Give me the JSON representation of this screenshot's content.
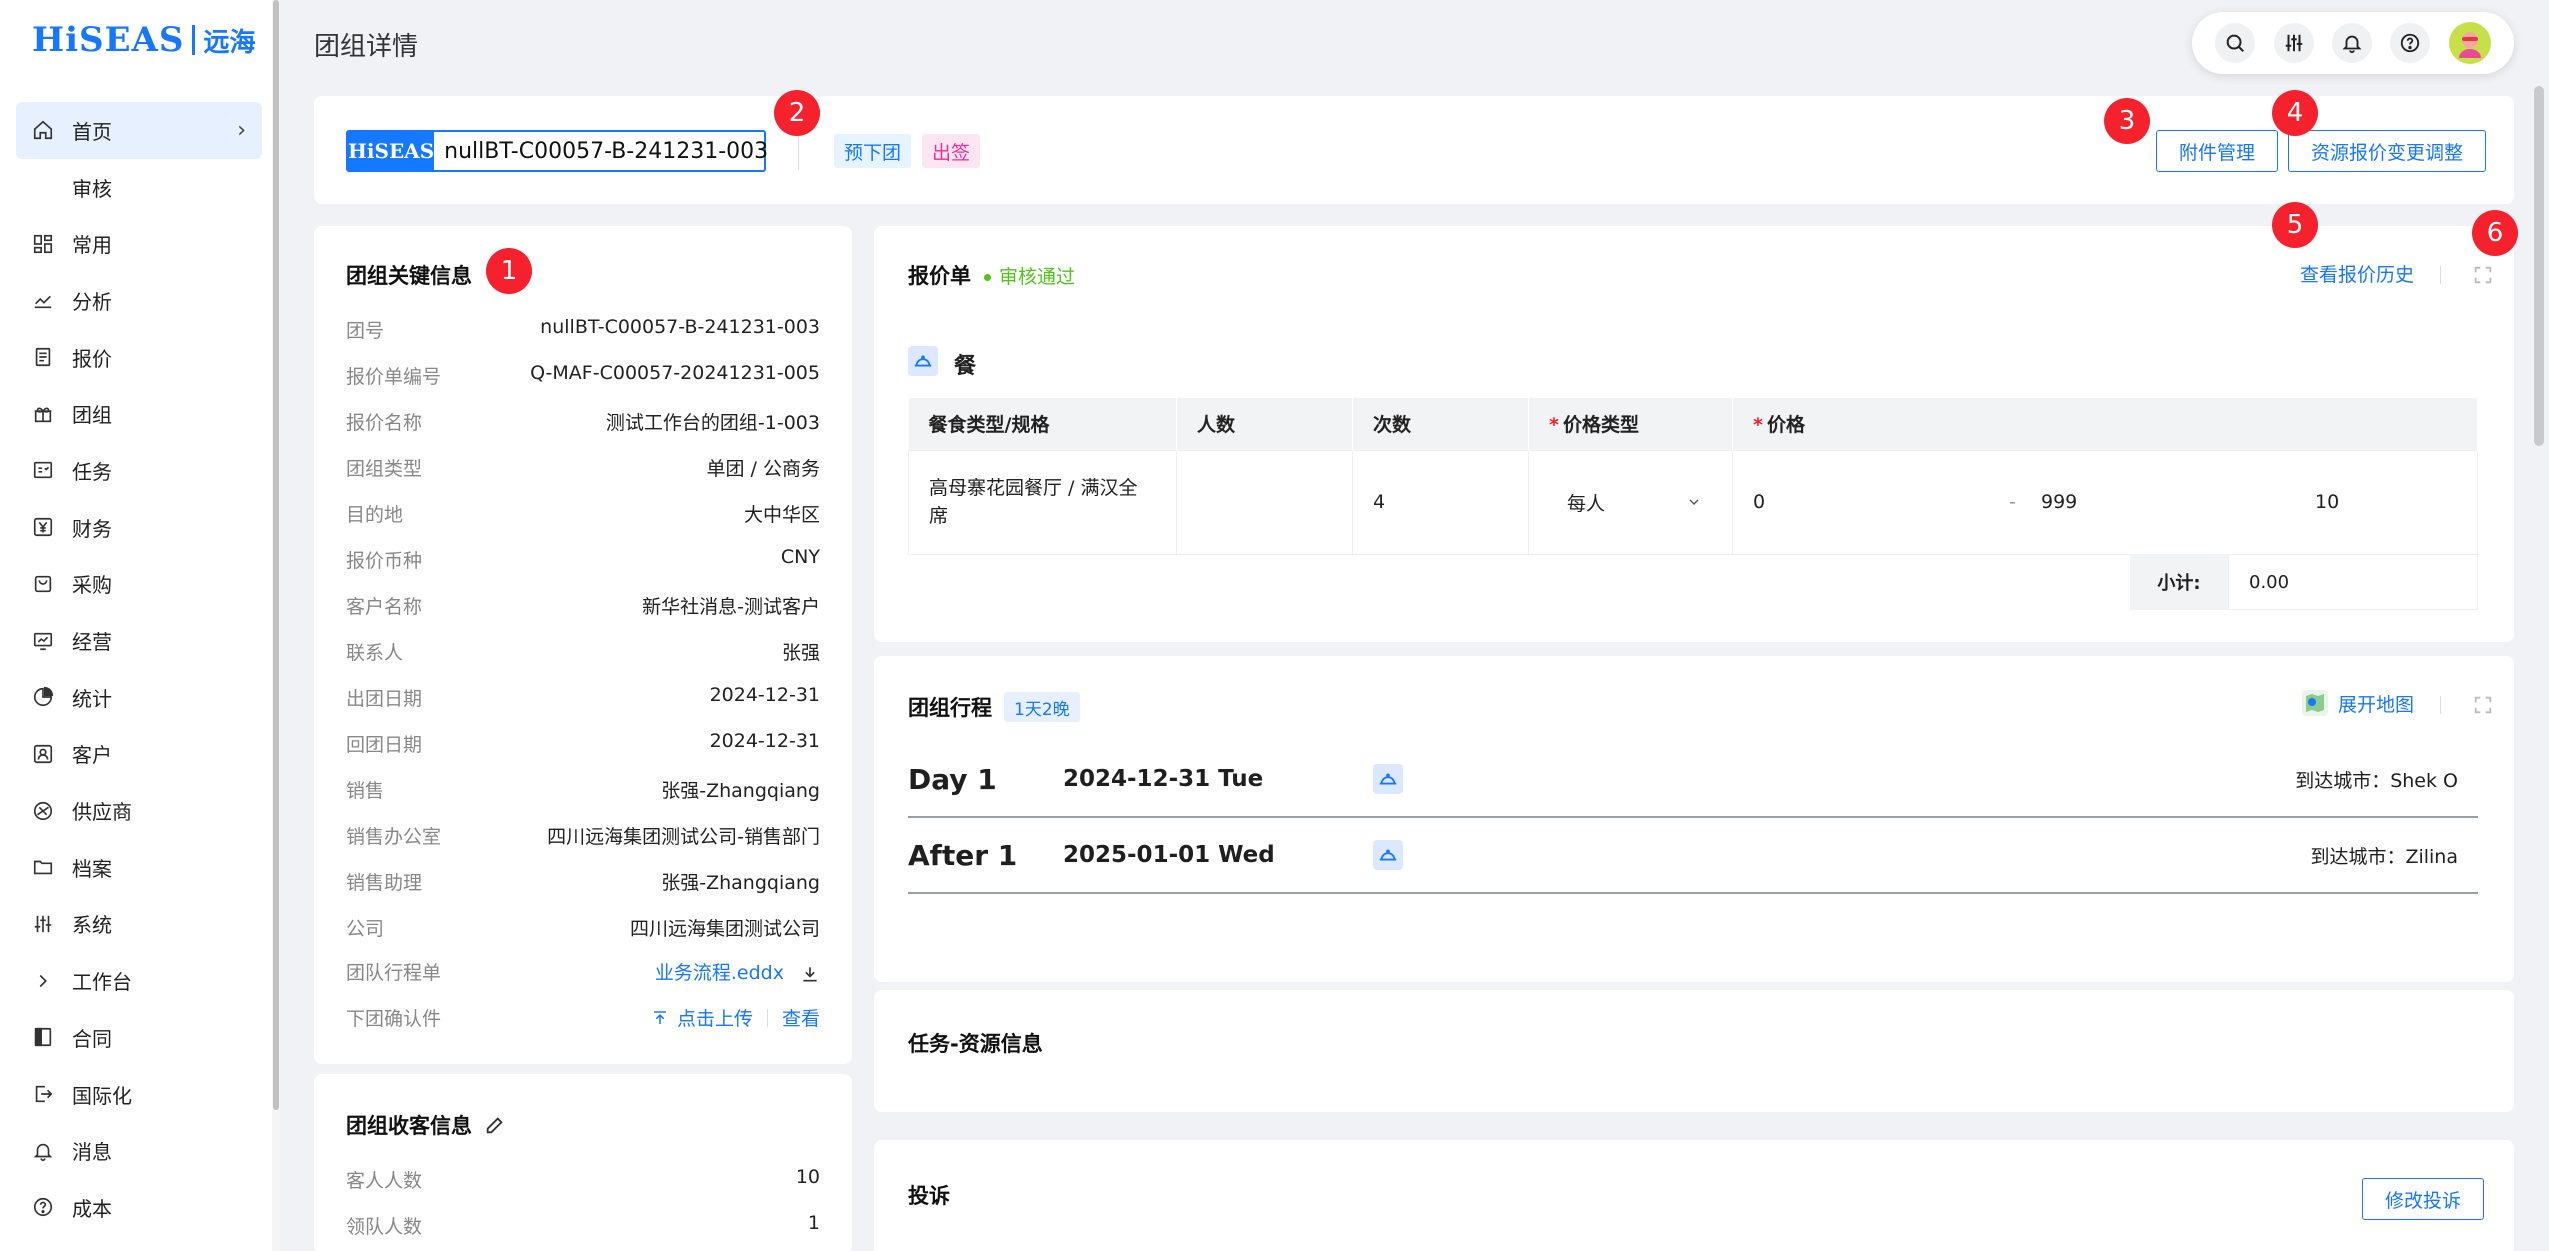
{
  "page": {
    "title": "团组详情"
  },
  "brand": {
    "logo_en": "HiSEAS",
    "logo_cn": "远海",
    "accent": "#1677ff",
    "danger": "#f5222d"
  },
  "sidebar": {
    "items": [
      {
        "label": "首页",
        "icon": "home-icon"
      },
      {
        "label": "审核",
        "icon": ""
      },
      {
        "label": "常用",
        "icon": "dashboard-icon"
      },
      {
        "label": "分析",
        "icon": "chart-line-icon"
      },
      {
        "label": "报价",
        "icon": "document-icon"
      },
      {
        "label": "团组",
        "icon": "gift-icon"
      },
      {
        "label": "任务",
        "icon": "task-icon"
      },
      {
        "label": "财务",
        "icon": "yen-icon"
      },
      {
        "label": "采购",
        "icon": "shopping-bag-icon"
      },
      {
        "label": "经营",
        "icon": "monitor-chart-icon"
      },
      {
        "label": "统计",
        "icon": "pie-chart-icon"
      },
      {
        "label": "客户",
        "icon": "customer-icon"
      },
      {
        "label": "供应商",
        "icon": "supplier-icon"
      },
      {
        "label": "档案",
        "icon": "folder-icon"
      },
      {
        "label": "系统",
        "icon": "sliders-icon"
      },
      {
        "label": "工作台",
        "icon": "chevron-right-icon"
      },
      {
        "label": "合同",
        "icon": "contract-icon"
      },
      {
        "label": "国际化",
        "icon": "logout-icon"
      },
      {
        "label": "消息",
        "icon": "bell-icon"
      },
      {
        "label": "成本",
        "icon": "help-circle-icon"
      }
    ]
  },
  "toolbar": {
    "icons": [
      "search-icon",
      "sliders-icon",
      "bell-icon",
      "help-icon",
      "avatar"
    ]
  },
  "header": {
    "group_logo": "HiSEAS",
    "group_code": "nullBT-C00057-B-241231-003",
    "tag_pre": "预下团",
    "tag_sign": "出签",
    "btn_attach": "附件管理",
    "btn_adjust": "资源报价变更调整",
    "markers": [
      "1",
      "2",
      "3",
      "4",
      "5",
      "6"
    ]
  },
  "key_info": {
    "title": "团组关键信息",
    "rows": [
      {
        "k": "团号",
        "v": "nullBT-C00057-B-241231-003"
      },
      {
        "k": "报价单编号",
        "v": "Q-MAF-C00057-20241231-005"
      },
      {
        "k": "报价名称",
        "v": "测试工作台的团组-1-003"
      },
      {
        "k": "团组类型",
        "v": "单团 / 公商务"
      },
      {
        "k": "目的地",
        "v": "大中华区"
      },
      {
        "k": "报价币种",
        "v": "CNY"
      },
      {
        "k": "客户名称",
        "v": "新华社消息-测试客户"
      },
      {
        "k": "联系人",
        "v": "张强"
      },
      {
        "k": "出团日期",
        "v": "2024-12-31"
      },
      {
        "k": "回团日期",
        "v": "2024-12-31"
      },
      {
        "k": "销售",
        "v": "张强-Zhangqiang"
      },
      {
        "k": "销售办公室",
        "v": "四川远海集团测试公司-销售部门"
      },
      {
        "k": "销售助理",
        "v": "张强-Zhangqiang"
      },
      {
        "k": "公司",
        "v": "四川远海集团测试公司"
      }
    ],
    "itinerary_label": "团队行程单",
    "itinerary_file": "业务流程.eddx",
    "confirm_label": "下团确认件",
    "upload": "点击上传",
    "view": "查看"
  },
  "guest_info": {
    "title": "团组收客信息",
    "rows": [
      {
        "k": "客人人数",
        "v": "10"
      },
      {
        "k": "领队人数",
        "v": "1"
      }
    ]
  },
  "quote": {
    "title": "报价单",
    "status": "审核通过",
    "history": "查看报价历史",
    "section": "餐",
    "headers": [
      "餐食类型/规格",
      "人数",
      "次数",
      "价格类型",
      "价格"
    ],
    "row": {
      "type": "高母寨花园餐厅 / 满汉全席",
      "people": "",
      "times": "4",
      "price_type": "每人",
      "price_from": "0",
      "dash": "-",
      "price_to": "999",
      "extra": "10"
    },
    "subtotal_label": "小计:",
    "subtotal_value": "0.00"
  },
  "itinerary": {
    "title": "团组行程",
    "days_badge": "1天2晚",
    "map_btn": "展开地图",
    "days": [
      {
        "name": "Day 1",
        "date": "2024-12-31 Tue",
        "city": "到达城市：Shek O"
      },
      {
        "name": "After 1",
        "date": "2025-01-01 Wed",
        "city": "到达城市：Zilina"
      }
    ]
  },
  "tasks": {
    "title": "任务-资源信息"
  },
  "complaint": {
    "title": "投诉",
    "btn": "修改投诉"
  }
}
